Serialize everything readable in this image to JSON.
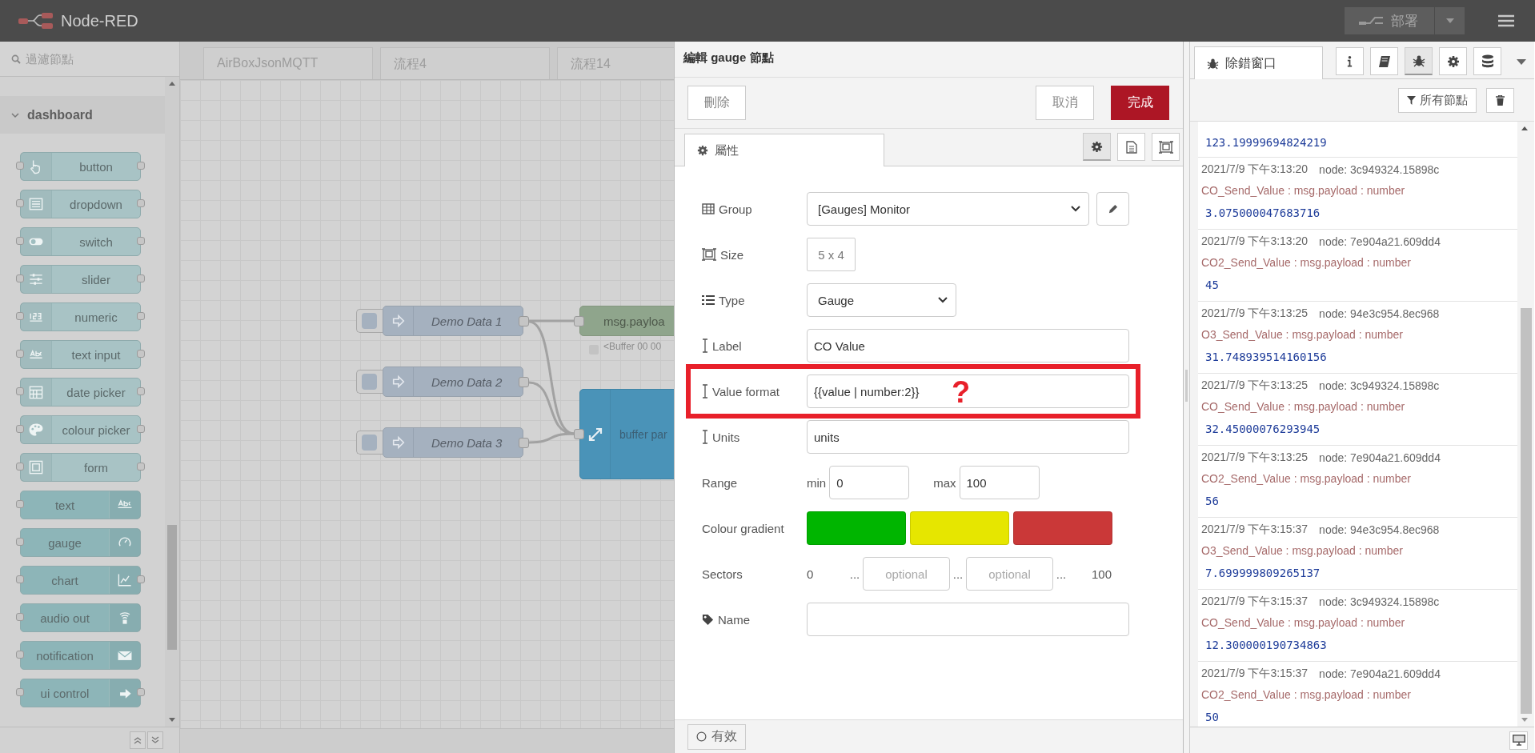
{
  "header": {
    "title": "Node-RED",
    "deploy": "部署"
  },
  "palette": {
    "filter_placeholder": "過濾節點",
    "category": {
      "label": "dashboard",
      "expanded": true
    },
    "nodes": [
      {
        "label": "button",
        "kind": "icon-left",
        "output": true
      },
      {
        "label": "dropdown",
        "kind": "icon-left",
        "output": true
      },
      {
        "label": "switch",
        "kind": "icon-left",
        "output": true
      },
      {
        "label": "slider",
        "kind": "icon-left",
        "output": true
      },
      {
        "label": "numeric",
        "kind": "icon-left",
        "output": true
      },
      {
        "label": "text input",
        "kind": "icon-left",
        "output": true
      },
      {
        "label": "date picker",
        "kind": "icon-left",
        "output": true
      },
      {
        "label": "colour picker",
        "kind": "icon-left",
        "output": true
      },
      {
        "label": "form",
        "kind": "icon-left",
        "output": true
      },
      {
        "label": "text",
        "kind": "icon-right",
        "output": false
      },
      {
        "label": "gauge",
        "kind": "icon-right",
        "output": false
      },
      {
        "label": "chart",
        "kind": "icon-right",
        "output": true
      },
      {
        "label": "audio out",
        "kind": "icon-right",
        "output": false
      },
      {
        "label": "notification",
        "kind": "icon-right",
        "output": false
      },
      {
        "label": "ui control",
        "kind": "icon-right",
        "output": true
      }
    ]
  },
  "workspace": {
    "tabs": [
      {
        "label": "AirBoxJsonMQTT",
        "selected": false
      },
      {
        "label": "流程4",
        "selected": false
      },
      {
        "label": "流程14",
        "selected": false
      }
    ],
    "nodes": [
      {
        "kind": "inject",
        "label": "Demo Data 1"
      },
      {
        "kind": "inject",
        "label": "Demo Data 2"
      },
      {
        "kind": "inject",
        "label": "Demo Data 3"
      },
      {
        "kind": "debug",
        "label": "msg.payloa",
        "status": "<Buffer 00 00"
      },
      {
        "kind": "function",
        "label": "buffer par"
      }
    ]
  },
  "editor": {
    "title": "編輯 gauge 節點",
    "delete": "刪除",
    "cancel": "取消",
    "done": "完成",
    "tab": {
      "label": "屬性",
      "selected": true
    },
    "side_tabs": [
      {
        "selected": true
      },
      {
        "selected": false
      },
      {
        "selected": false
      }
    ],
    "fields": [
      {
        "kind": "select",
        "label": "Group",
        "value": "[Gauges] Monitor",
        "edit_button": true
      },
      {
        "kind": "size",
        "label": "Size",
        "value": "5 x 4"
      },
      {
        "kind": "select",
        "label": "Type",
        "value": "Gauge",
        "edit_button": false
      },
      {
        "kind": "text",
        "label": "Label",
        "value": "CO Value"
      },
      {
        "kind": "text",
        "label": "Value format",
        "value": "{{value | number:2}}",
        "highlighted": true,
        "annotation": "?"
      },
      {
        "kind": "text",
        "label": "Units",
        "value": "units"
      },
      {
        "kind": "range",
        "label": "Range",
        "min_label": "min",
        "min": "0",
        "max_label": "max",
        "max": "100"
      },
      {
        "kind": "gradient",
        "label": "Colour gradient",
        "swatches": [
          {
            "color": "#00b500"
          },
          {
            "color": "#e6e600"
          },
          {
            "color": "#ca3838"
          }
        ]
      },
      {
        "kind": "sectors",
        "label": "Sectors",
        "start": "0",
        "end": "100",
        "separators": [
          "...",
          "...",
          "..."
        ],
        "placeholders": [
          "optional",
          "optional"
        ]
      },
      {
        "kind": "text",
        "label": "Name"
      }
    ],
    "footer": {
      "label": "有效"
    }
  },
  "debug": {
    "tab": {
      "label": "除錯窗口",
      "selected": true
    },
    "side_tabs": [
      {
        "selected": false
      },
      {
        "selected": false
      },
      {
        "selected": true
      },
      {
        "selected": false
      },
      {
        "selected": false
      }
    ],
    "filter": "所有節點",
    "messages": [
      {
        "value": "123.19999694824219"
      },
      {
        "time": "2021/7/9 下午3:13:20",
        "node": "node: 3c949324.15898c",
        "topic": "CO_Send_Value : msg.payload : number",
        "value": "3.075000047683716"
      },
      {
        "time": "2021/7/9 下午3:13:20",
        "node": "node: 7e904a21.609dd4",
        "topic": "CO2_Send_Value : msg.payload : number",
        "value": "45"
      },
      {
        "time": "2021/7/9 下午3:13:25",
        "node": "node: 94e3c954.8ec968",
        "topic": "O3_Send_Value : msg.payload : number",
        "value": "31.748939514160156"
      },
      {
        "time": "2021/7/9 下午3:13:25",
        "node": "node: 3c949324.15898c",
        "topic": "CO_Send_Value : msg.payload : number",
        "value": "32.45000076293945"
      },
      {
        "time": "2021/7/9 下午3:13:25",
        "node": "node: 7e904a21.609dd4",
        "topic": "CO2_Send_Value : msg.payload : number",
        "value": "56"
      },
      {
        "time": "2021/7/9 下午3:15:37",
        "node": "node: 94e3c954.8ec968",
        "topic": "O3_Send_Value : msg.payload : number",
        "value": "7.699999809265137"
      },
      {
        "time": "2021/7/9 下午3:15:37",
        "node": "node: 3c949324.15898c",
        "topic": "CO_Send_Value : msg.payload : number",
        "value": "12.300000190734863"
      },
      {
        "time": "2021/7/9 下午3:15:37",
        "node": "node: 7e904a21.609dd4",
        "topic": "CO2_Send_Value : msg.payload : number",
        "value": "50"
      }
    ]
  }
}
